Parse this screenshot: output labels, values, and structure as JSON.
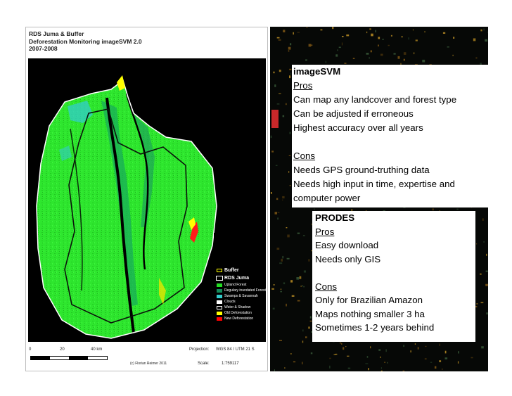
{
  "map": {
    "title_lines": [
      "RDS Juma & Buffer",
      "Deforestation Monitoring imageSVM 2.0",
      "2007-2008"
    ],
    "legend": [
      {
        "label": "Buffer",
        "color": "#ffff00",
        "style": "outline",
        "big": true
      },
      {
        "label": "RDS Juma",
        "color": "#ffffff",
        "style": "outline-dark",
        "big": true
      },
      {
        "label": "Upland Forest",
        "color": "#22dd22",
        "style": "fill",
        "big": false
      },
      {
        "label": "Regulary inundated Forest",
        "color": "#138a5a",
        "style": "fill",
        "big": false
      },
      {
        "label": "Swamps & Savannah",
        "color": "#33cccc",
        "style": "fill",
        "big": false
      },
      {
        "label": "Clouds",
        "color": "#ffffff",
        "style": "fill",
        "big": false
      },
      {
        "label": "Water & Shadow",
        "color": "#000000",
        "style": "fill-outline",
        "big": false
      },
      {
        "label": "Old Deforestation",
        "color": "#ffff00",
        "style": "fill",
        "big": false
      },
      {
        "label": "New Deforestation",
        "color": "#ff0000",
        "style": "fill",
        "big": false
      }
    ],
    "scale_ticks": [
      "0",
      "20",
      "40 km"
    ],
    "projection_label": "Projection:",
    "projection_value": "WGS 84 / UTM 21 S",
    "credit": "(c) Florian Reimer 2011",
    "scale_label": "Scale:",
    "scale_value": "1:759117"
  },
  "imagesvm": {
    "title": "imageSVM",
    "pros_heading": "Pros",
    "pros": [
      "Can map any landcover and forest type",
      "Can be adjusted if erroneous",
      "Highest accuracy over all years"
    ],
    "cons_heading": "Cons",
    "cons": [
      "Needs GPS ground-truthing data",
      "Needs high input in time, expertise and",
      "computer power"
    ]
  },
  "prodes": {
    "title": "PRODES",
    "pros_heading": "Pros",
    "pros": [
      "Easy download",
      "Needs only GIS"
    ],
    "cons_heading": "Cons",
    "cons": [
      "Only for Brazilian Amazon",
      "Maps nothing smaller 3 ha",
      "Sometimes 1-2 years behind"
    ]
  }
}
